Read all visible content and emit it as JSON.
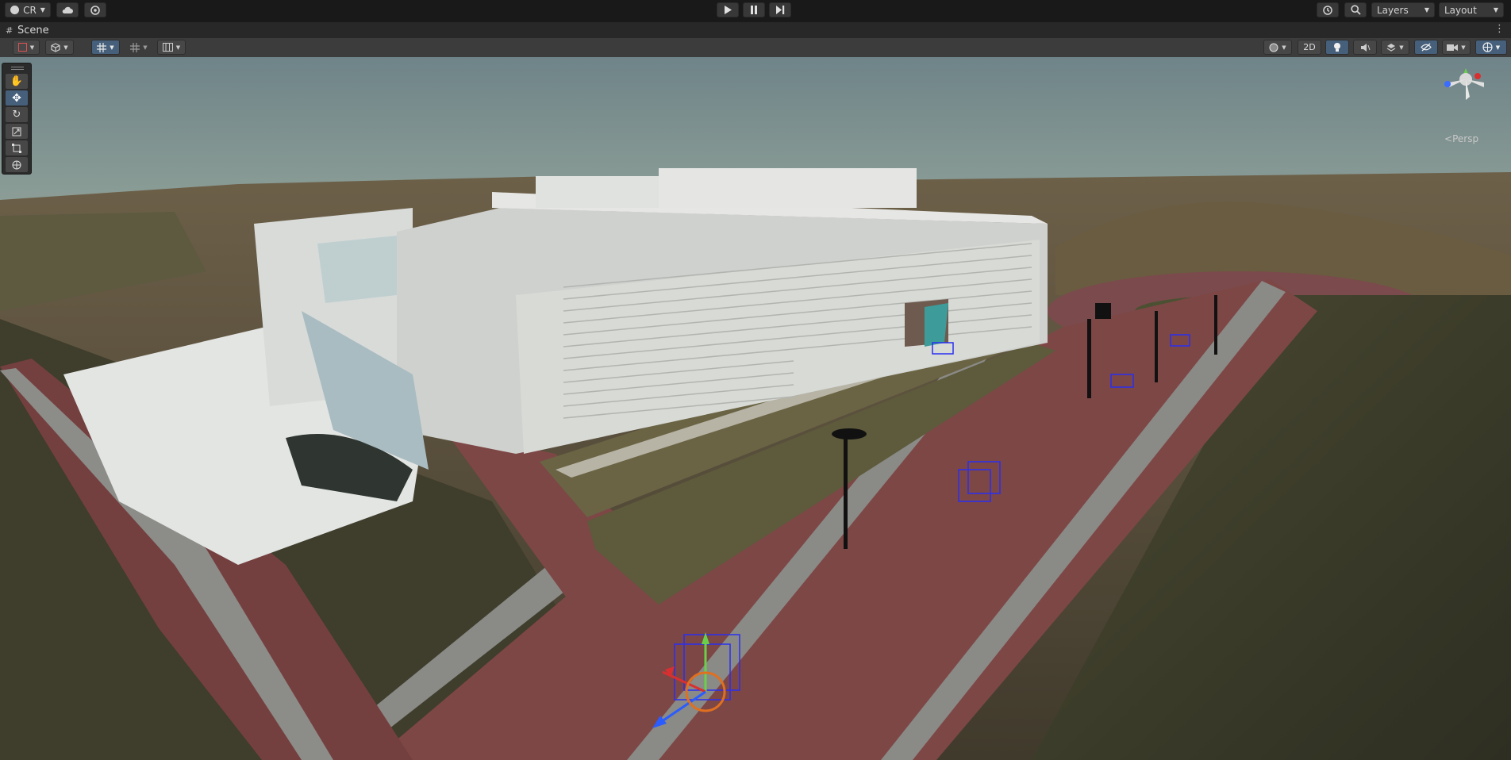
{
  "topbar": {
    "account_label": "CR",
    "layers_label": "Layers",
    "layout_label": "Layout",
    "icons": [
      "account-icon",
      "cloud-icon",
      "collab-icon",
      "play-icon",
      "pause-icon",
      "step-icon",
      "history-icon",
      "search-icon"
    ]
  },
  "tab": {
    "title": "Scene"
  },
  "scene_toolbar": {
    "two_d_label": "2D",
    "accent": "#46607c"
  },
  "tools": {
    "items": [
      "hand-tool",
      "move-tool",
      "rotate-tool",
      "scale-tool",
      "rect-tool",
      "transform-tool"
    ],
    "active": "move-tool"
  },
  "gizmo": {
    "projection_label": "Persp"
  }
}
